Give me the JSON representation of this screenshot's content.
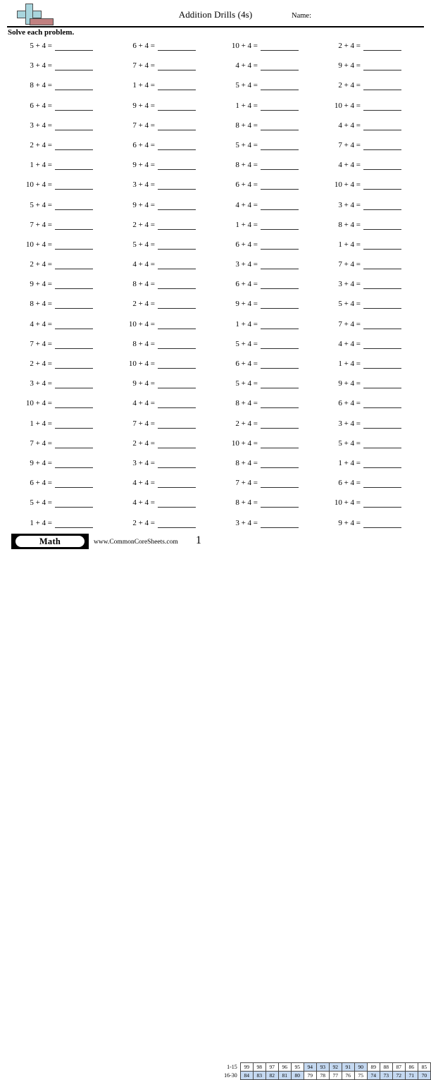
{
  "header": {
    "title": "Addition Drills (4s)",
    "name_label": "Name:",
    "instructions": "Solve each problem.",
    "logo_name": "plus-book-logo"
  },
  "problem_suffix": "+ 4 =",
  "columns": [
    {
      "operands": [
        5,
        3,
        8,
        6,
        3,
        2,
        1,
        10,
        5,
        7,
        10,
        2,
        9,
        8,
        4,
        7,
        2,
        3,
        10,
        1,
        7,
        9,
        6,
        5,
        1
      ]
    },
    {
      "operands": [
        6,
        7,
        1,
        9,
        7,
        6,
        9,
        3,
        9,
        2,
        5,
        4,
        8,
        2,
        10,
        8,
        10,
        9,
        4,
        7,
        2,
        3,
        4,
        4,
        2
      ]
    },
    {
      "operands": [
        10,
        4,
        5,
        1,
        8,
        5,
        8,
        6,
        4,
        1,
        6,
        3,
        6,
        9,
        1,
        5,
        6,
        5,
        8,
        2,
        10,
        8,
        7,
        8,
        3
      ]
    },
    {
      "operands": [
        2,
        9,
        2,
        10,
        4,
        7,
        4,
        10,
        3,
        8,
        1,
        7,
        3,
        5,
        7,
        4,
        1,
        9,
        6,
        3,
        5,
        1,
        6,
        10,
        9
      ]
    }
  ],
  "footer": {
    "badge_label": "Math",
    "site_url": "www.CommonCoreSheets.com",
    "page_number": "1"
  },
  "score_table": {
    "row1_label": "1-15",
    "row2_label": "16-30",
    "row1_values": [
      99,
      98,
      97,
      96,
      95,
      94,
      93,
      92,
      91,
      90,
      89,
      88,
      87,
      86,
      85
    ],
    "row2_values": [
      84,
      83,
      82,
      81,
      80,
      79,
      78,
      77,
      76,
      75,
      74,
      73,
      72,
      71,
      70
    ],
    "row1_highlighted": [
      false,
      false,
      false,
      false,
      false,
      true,
      true,
      true,
      true,
      true,
      false,
      false,
      false,
      false,
      false
    ],
    "row2_highlighted": [
      true,
      true,
      true,
      true,
      true,
      false,
      false,
      false,
      false,
      false,
      true,
      true,
      true,
      true,
      true
    ],
    "highlight_color": "#c5d9f1"
  }
}
